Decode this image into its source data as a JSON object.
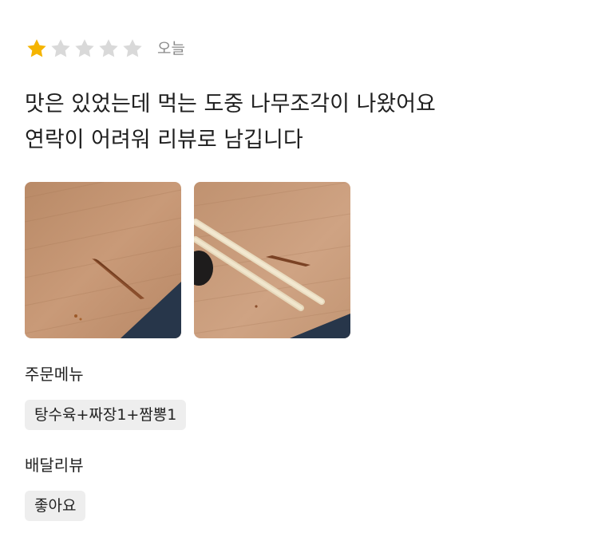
{
  "review": {
    "rating": 1,
    "max_rating": 5,
    "date": "오늘",
    "text_lines": [
      "맛은 있었는데 먹는 도중 나무조각이 나왔어요",
      "연락이 어려워 리뷰로 남깁니다"
    ],
    "photo_count": 2
  },
  "colors": {
    "star_filled": "#F5B400",
    "star_empty": "#D9D9D9",
    "chip_bg": "#EEEEEE",
    "date_text": "#8A8A8A"
  },
  "order_menu": {
    "label": "주문메뉴",
    "items": [
      "탕수육+짜장1+짬뽕1"
    ]
  },
  "delivery_review": {
    "label": "배달리뷰",
    "value": "좋아요"
  }
}
